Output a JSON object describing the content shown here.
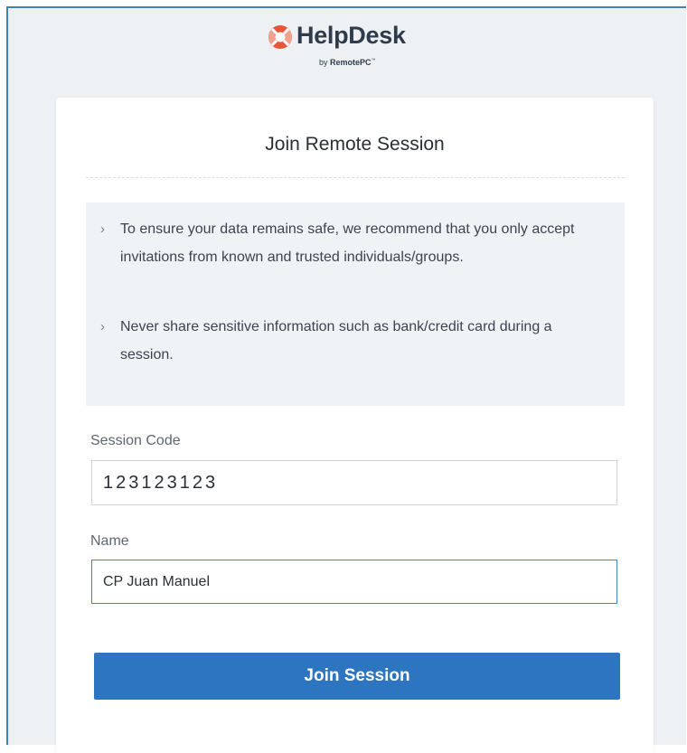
{
  "brand": {
    "title": "HelpDesk",
    "byline_prefix": "by",
    "byline_company": "RemotePC",
    "byline_tm": "™",
    "logo_icon": "lifebuoy-icon",
    "colors": {
      "logo_accent": "#e8563a",
      "frame_border": "#3f7fc4"
    }
  },
  "card": {
    "title": "Join Remote Session"
  },
  "notice": {
    "items": [
      {
        "icon": "chevron-right-icon",
        "chevron": "›",
        "text": "To ensure your data remains safe, we recommend that you only accept invitations from known and trusted individuals/groups."
      },
      {
        "icon": "chevron-right-icon",
        "chevron": "›",
        "text": "Never share sensitive information such as bank/credit card during a session."
      }
    ]
  },
  "form": {
    "session_code_label": "Session Code",
    "session_code_value": "123123123",
    "name_label": "Name",
    "name_value": "CP Juan Manuel",
    "submit_label": "Join Session"
  },
  "theme": {
    "button_color": "#2d74c1",
    "notice_bg": "#eef3f6",
    "page_bg": "#eef1f3"
  }
}
